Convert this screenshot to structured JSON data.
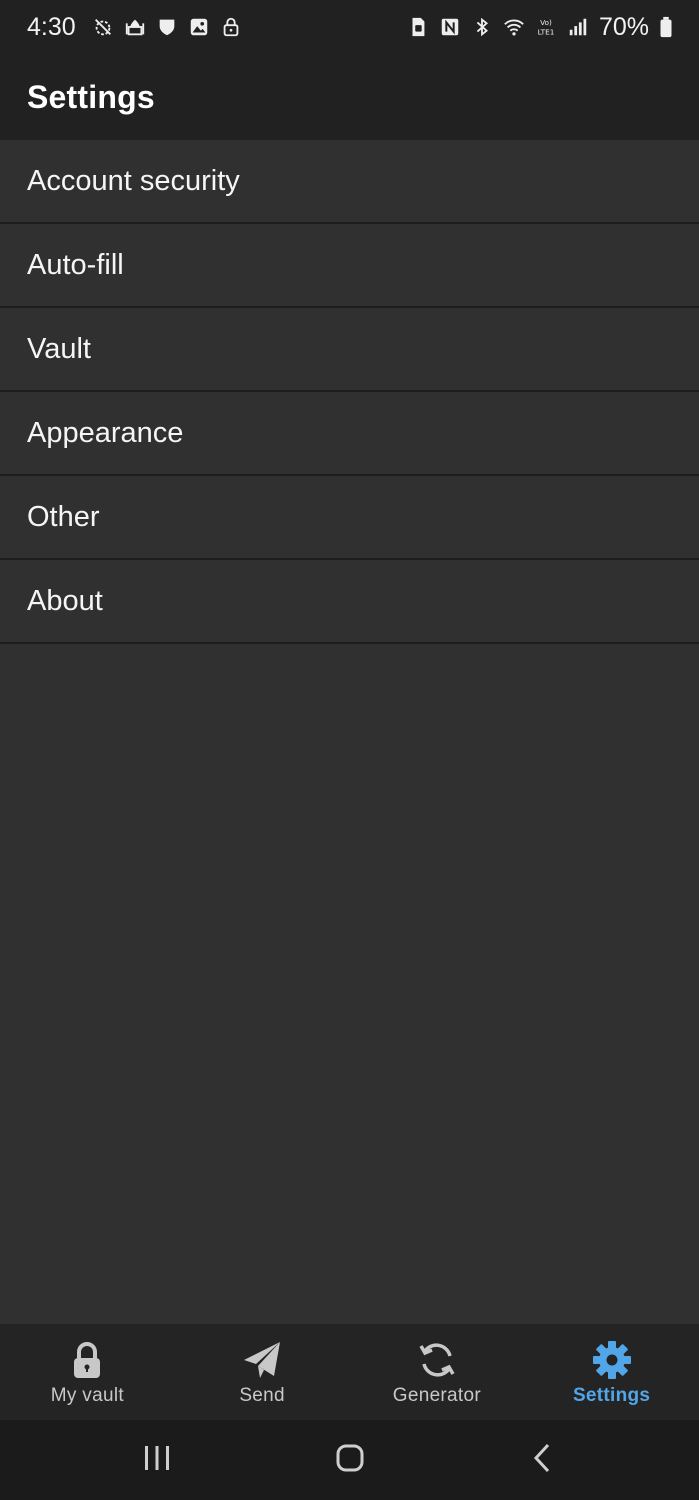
{
  "status_bar": {
    "time": "4:30",
    "battery_percent": "70%",
    "left_icons": [
      "alarm-off-icon",
      "mosque-icon",
      "shield-icon",
      "image-icon",
      "lock-icon"
    ],
    "right_icons": [
      "sim-icon",
      "nfc-icon",
      "bluetooth-icon",
      "wifi-icon",
      "volte-icon",
      "signal-icon",
      "battery-icon"
    ]
  },
  "app_bar": {
    "title": "Settings"
  },
  "settings": {
    "items": [
      {
        "label": "Account security"
      },
      {
        "label": "Auto-fill"
      },
      {
        "label": "Vault"
      },
      {
        "label": "Appearance"
      },
      {
        "label": "Other"
      },
      {
        "label": "About"
      }
    ]
  },
  "bottom_nav": {
    "active_color": "#52a6e8",
    "items": [
      {
        "label": "My vault",
        "icon": "lock-icon",
        "active": false
      },
      {
        "label": "Send",
        "icon": "send-icon",
        "active": false
      },
      {
        "label": "Generator",
        "icon": "refresh-icon",
        "active": false
      },
      {
        "label": "Settings",
        "icon": "gear-icon",
        "active": true
      }
    ]
  },
  "system_nav": {
    "buttons": [
      "recents-icon",
      "home-icon",
      "back-icon"
    ]
  }
}
